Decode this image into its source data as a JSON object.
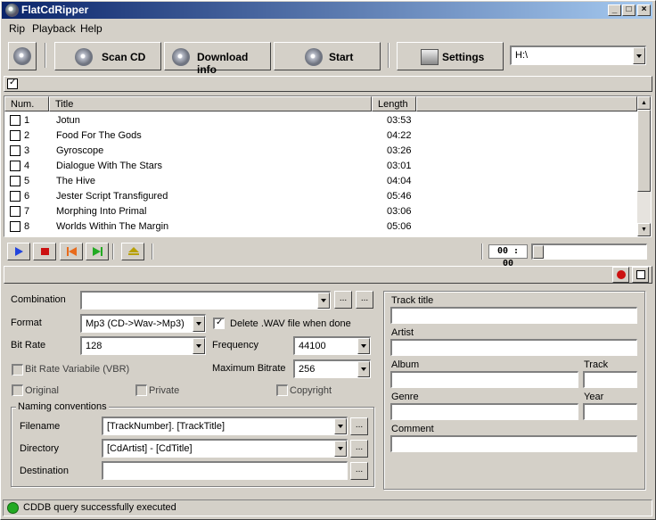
{
  "window": {
    "title": "FlatCdRipper"
  },
  "menu": [
    "Rip",
    "Playback",
    "Help"
  ],
  "toolbar": {
    "scan_label": "Scan CD",
    "download_label": "Download info",
    "start_label": "Start",
    "settings_label": "Settings",
    "drive": "H:\\"
  },
  "tracklist": {
    "columns": [
      "Num.",
      "Title",
      "Length"
    ],
    "rows": [
      {
        "num": "1",
        "title": "Jotun",
        "length": "03:53"
      },
      {
        "num": "2",
        "title": "Food For The Gods",
        "length": "04:22"
      },
      {
        "num": "3",
        "title": "Gyroscope",
        "length": "03:26"
      },
      {
        "num": "4",
        "title": "Dialogue With The Stars",
        "length": "03:01"
      },
      {
        "num": "5",
        "title": "The Hive",
        "length": "04:04"
      },
      {
        "num": "6",
        "title": "Jester Script Transfigured",
        "length": "05:46"
      },
      {
        "num": "7",
        "title": "Morphing Into Primal",
        "length": "03:06"
      },
      {
        "num": "8",
        "title": "Worlds Within The Margin",
        "length": "05:06"
      }
    ]
  },
  "player": {
    "time": "00 : 00"
  },
  "settings": {
    "combination_label": "Combination",
    "combination_value": "",
    "format_label": "Format",
    "format_value": "Mp3 (CD->Wav->Mp3)",
    "delete_wav_label": "Delete .WAV file when done",
    "bitrate_label": "Bit Rate",
    "bitrate_value": "128",
    "frequency_label": "Frequency",
    "frequency_value": "44100",
    "vbr_label": "Bit Rate Variabile (VBR)",
    "max_bitrate_label": "Maximum Bitrate",
    "max_bitrate_value": "256",
    "original_label": "Original",
    "private_label": "Private",
    "copyright_label": "Copyright",
    "naming_label": "Naming conventions",
    "filename_label": "Filename",
    "filename_value": "[TrackNumber]. [TrackTitle]",
    "directory_label": "Directory",
    "directory_value": "[CdArtist] - [CdTitle]",
    "destination_label": "Destination",
    "destination_value": "",
    "ellipsis": "..."
  },
  "tags": {
    "track_title_label": "Track title",
    "artist_label": "Artist",
    "album_label": "Album",
    "track_label": "Track",
    "genre_label": "Genre",
    "year_label": "Year",
    "comment_label": "Comment"
  },
  "status": {
    "message": "CDDB query successfully executed",
    "color": "#22aa22"
  }
}
